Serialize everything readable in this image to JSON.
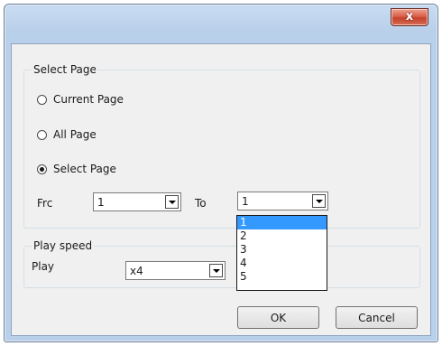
{
  "window": {
    "close_symbol": "x"
  },
  "select_page": {
    "title": "Select Page",
    "options": [
      {
        "label": "Current Page",
        "checked": false
      },
      {
        "label": "All Page",
        "checked": false
      },
      {
        "label": "Select Page",
        "checked": true
      }
    ],
    "from_label": "Frc",
    "from_value": "1",
    "to_label": "To",
    "to_value": "1",
    "to_dropdown_options": [
      "1",
      "2",
      "3",
      "4",
      "5"
    ],
    "to_dropdown_selected": "1"
  },
  "play_speed": {
    "title": "Play speed",
    "play_label": "Play",
    "play_value": "x4"
  },
  "buttons": {
    "ok": "OK",
    "cancel": "Cancel"
  },
  "colors": {
    "selection": "#3399ff",
    "close_button": "#c5432c"
  }
}
